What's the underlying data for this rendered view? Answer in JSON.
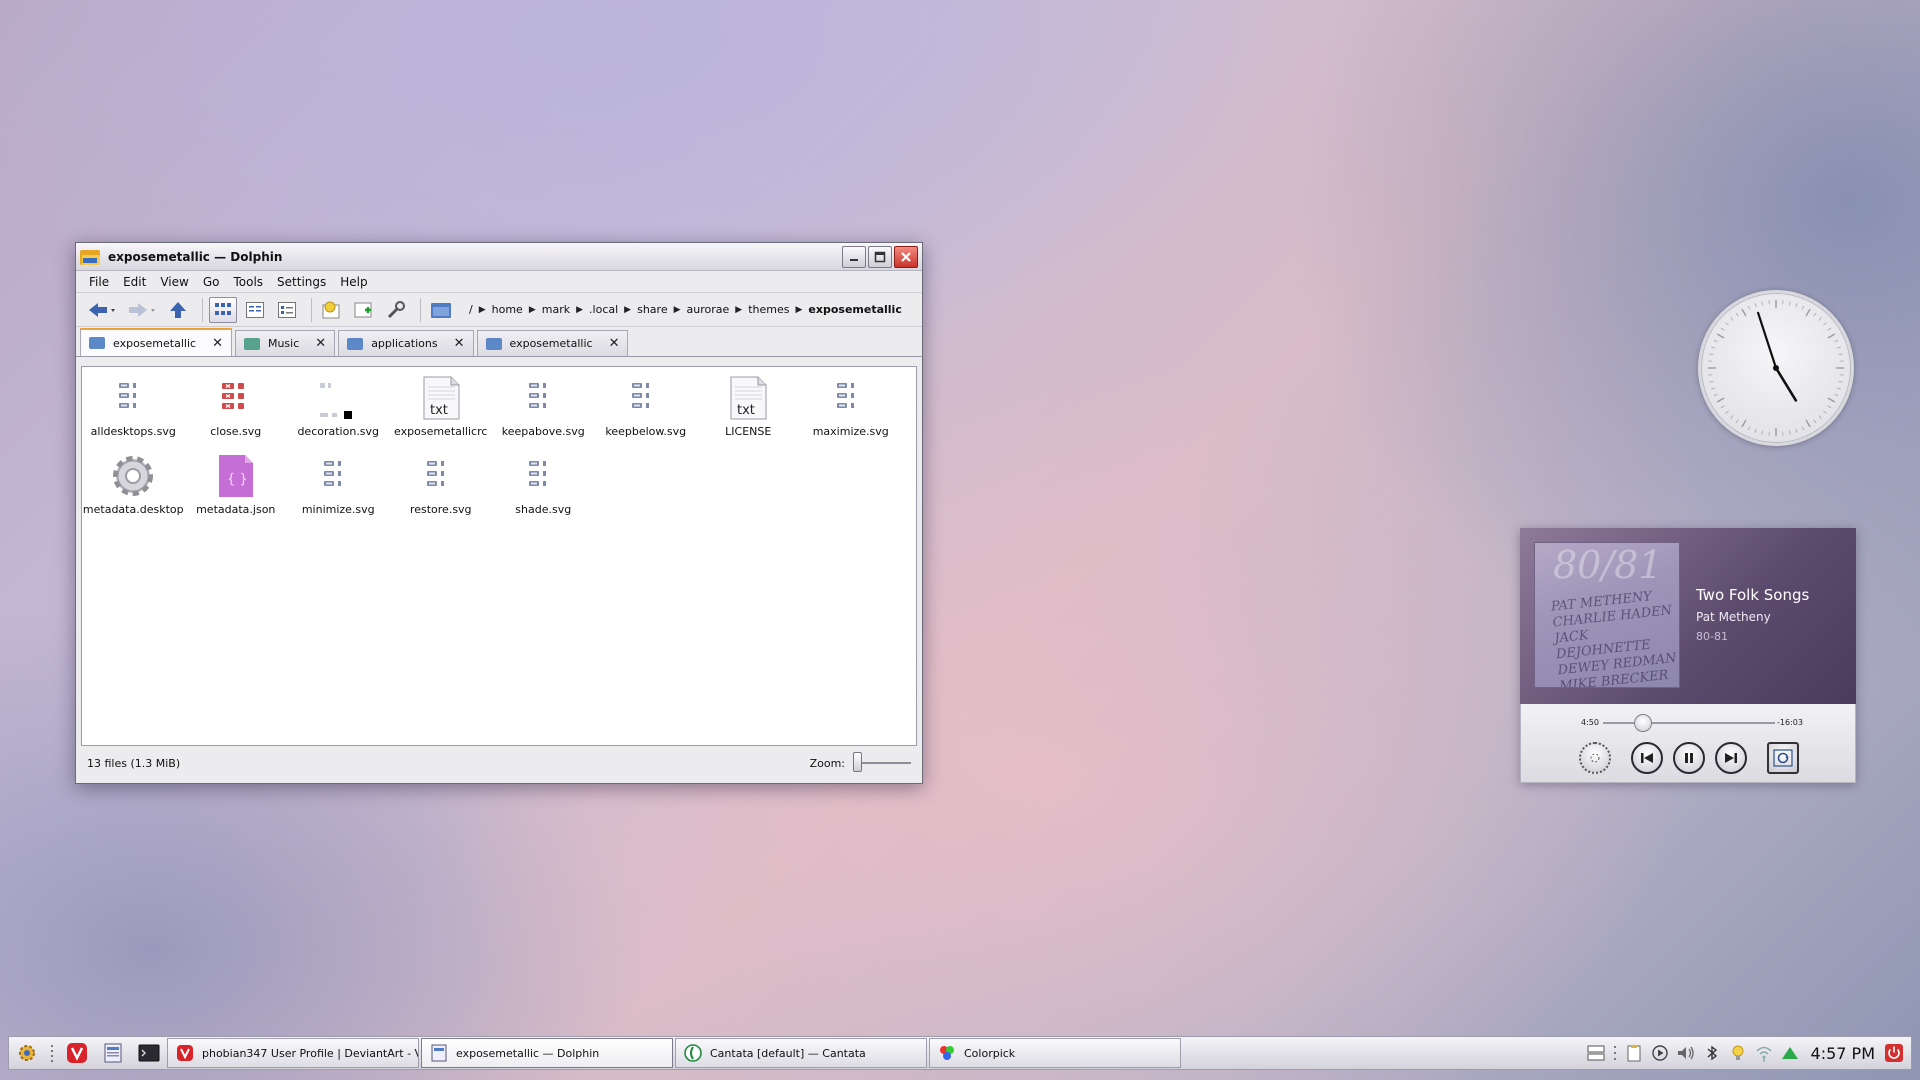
{
  "window": {
    "title": "exposemetallic — Dolphin",
    "menu": [
      "File",
      "Edit",
      "View",
      "Go",
      "Tools",
      "Settings",
      "Help"
    ],
    "breadcrumb_root": "/",
    "breadcrumbs": [
      "home",
      "mark",
      ".local",
      "share",
      "aurorae",
      "themes",
      "exposemetallic"
    ],
    "tabs": [
      "exposemetallic",
      "Music",
      "applications",
      "exposemetallic"
    ],
    "files": [
      {
        "name": "alldesktops.svg",
        "icon": "svg-grid-icon"
      },
      {
        "name": "close.svg",
        "icon": "svg-red-grid-icon"
      },
      {
        "name": "decoration.svg",
        "icon": "svg-decoration-icon"
      },
      {
        "name": "exposemetallicrc",
        "icon": "txt-file-icon"
      },
      {
        "name": "keepabove.svg",
        "icon": "svg-grid-icon"
      },
      {
        "name": "keepbelow.svg",
        "icon": "svg-grid-icon"
      },
      {
        "name": "LICENSE",
        "icon": "txt-file-icon"
      },
      {
        "name": "maximize.svg",
        "icon": "svg-grid-icon"
      },
      {
        "name": "metadata.desktop",
        "icon": "gear-icon"
      },
      {
        "name": "metadata.json",
        "icon": "json-file-icon"
      },
      {
        "name": "minimize.svg",
        "icon": "svg-grid-icon"
      },
      {
        "name": "restore.svg",
        "icon": "svg-grid-icon"
      },
      {
        "name": "shade.svg",
        "icon": "svg-grid-icon"
      }
    ],
    "txt_label": "txt",
    "json_label": "{ }",
    "status": "13 files (1.3 MiB)",
    "zoom_label": "Zoom:"
  },
  "clock": {
    "hour": 4,
    "minute": 57
  },
  "player": {
    "title": "Two Folk Songs",
    "artist": "Pat Metheny",
    "album": "80-81",
    "cover_year": "80/81",
    "cover_names": [
      "PAT METHENY",
      "CHARLIE HADEN",
      "JACK DEJOHNETTE",
      "DEWEY REDMAN",
      "MIKE BRECKER"
    ],
    "elapsed": "4:50",
    "remaining": "-16:03",
    "progress": 0.23
  },
  "taskbar": {
    "tasks": [
      {
        "label": "phobian347 User Profile | DeviantArt - Vi...",
        "icon": "vivaldi-icon"
      },
      {
        "label": "exposemetallic — Dolphin",
        "icon": "dolphin-icon"
      },
      {
        "label": "Cantata [default] — Cantata",
        "icon": "cantata-icon"
      },
      {
        "label": "Colorpick",
        "icon": "colorpick-icon"
      }
    ],
    "time": "4:57 PM"
  }
}
